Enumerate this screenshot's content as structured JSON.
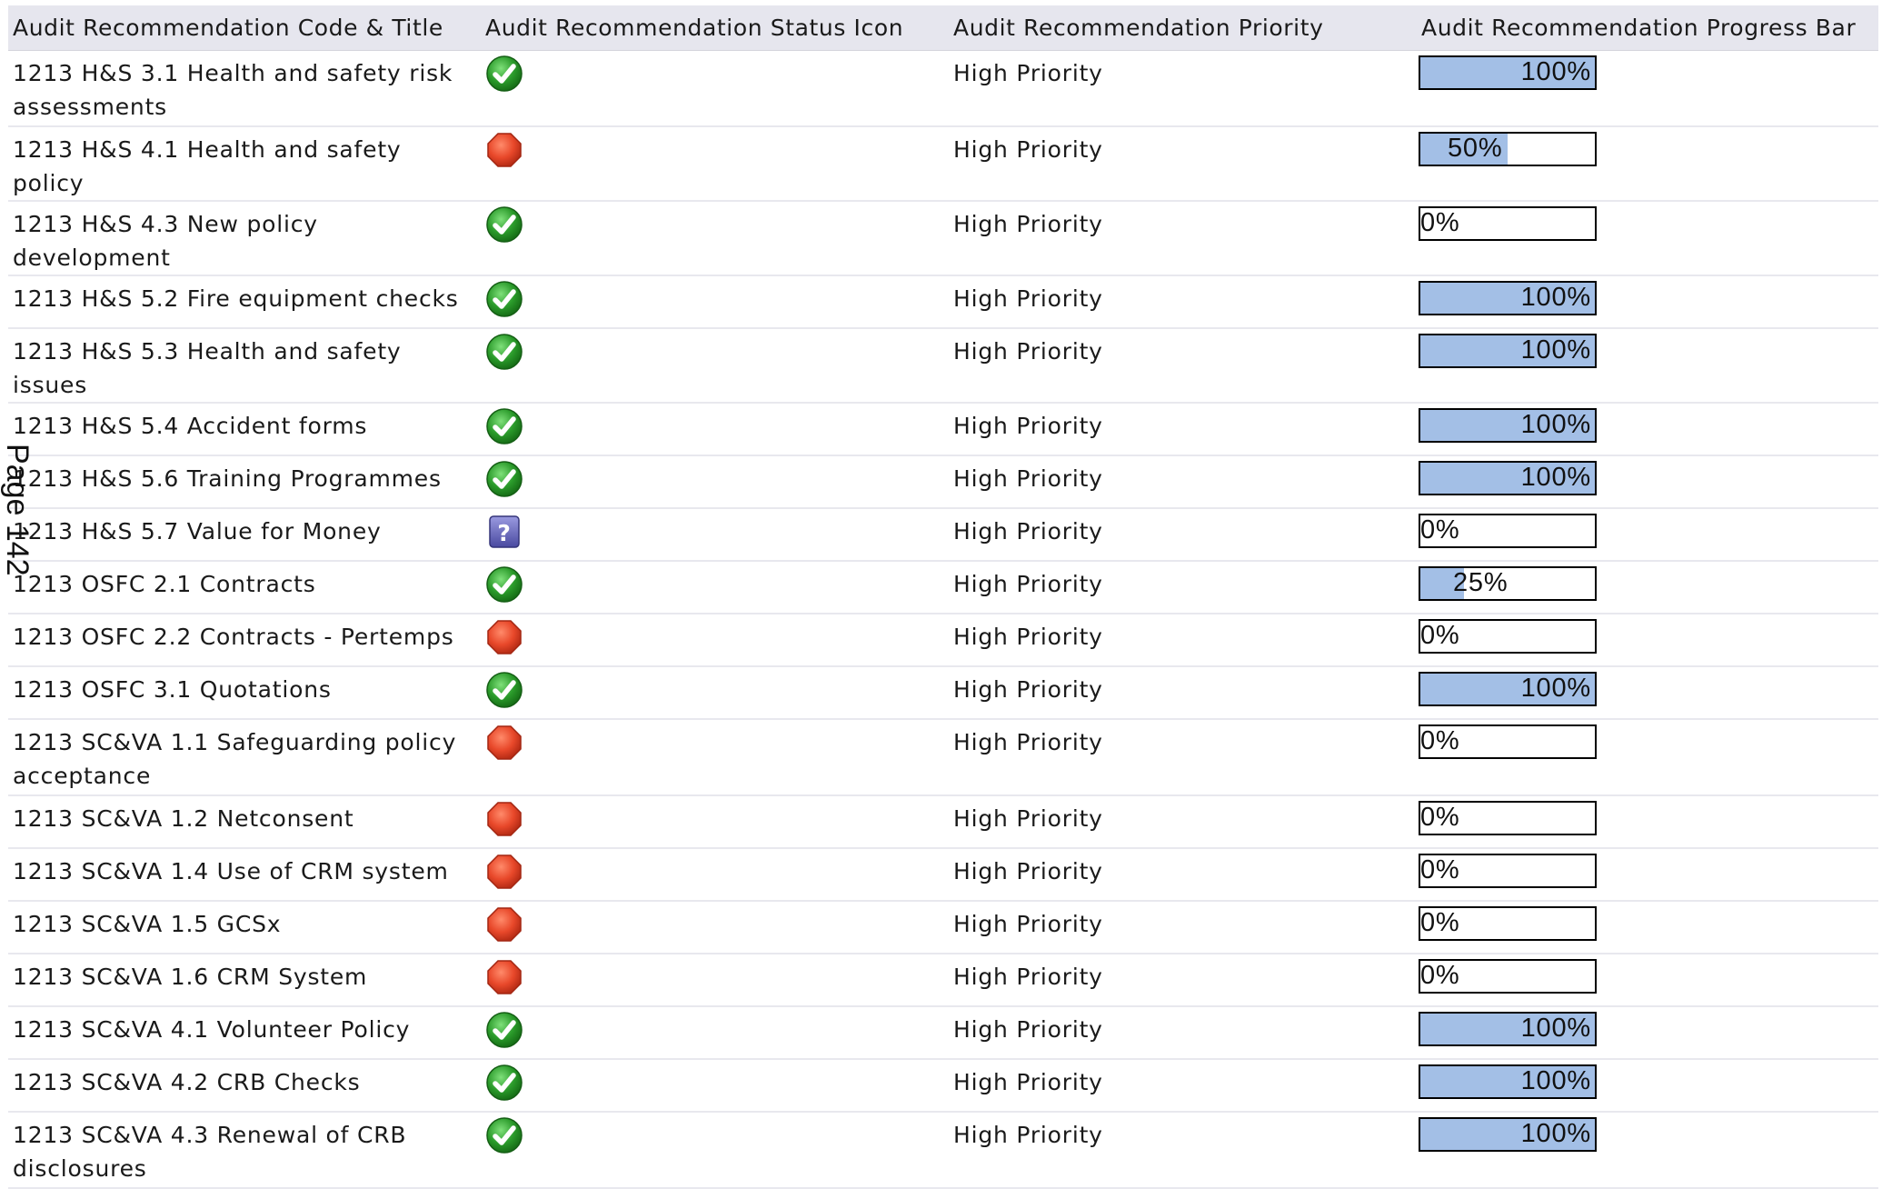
{
  "headers": [
    "Audit Recommendation Code & Title",
    "Audit Recommendation Status Icon",
    "Audit Recommendation Priority",
    "Audit Recommendation Progress Bar"
  ],
  "page_label": "Page 142",
  "status_colors": {
    "complete": "#2a9a2a",
    "not-started": "#e8482a",
    "unknown": "#5a5ab0"
  },
  "progress_fill_color": "#a3bfe6",
  "rows": [
    {
      "title": "1213 H&S 3.1 Health and safety risk assessments",
      "status_icon": "check-icon",
      "priority": "High Priority",
      "progress": 100,
      "progress_label": "100%"
    },
    {
      "title": "1213 H&S 4.1 Health and safety policy",
      "status_icon": "stop-octagon-icon",
      "priority": "High Priority",
      "progress": 50,
      "progress_label": "50%"
    },
    {
      "title": "1213 H&S 4.3 New policy development",
      "status_icon": "check-icon",
      "priority": "High Priority",
      "progress": 0,
      "progress_label": "0%"
    },
    {
      "title": "1213 H&S 5.2 Fire equipment checks",
      "status_icon": "check-icon",
      "priority": "High Priority",
      "progress": 100,
      "progress_label": "100%"
    },
    {
      "title": "1213 H&S 5.3 Health and safety issues",
      "status_icon": "check-icon",
      "priority": "High Priority",
      "progress": 100,
      "progress_label": "100%"
    },
    {
      "title": "1213 H&S 5.4 Accident forms",
      "status_icon": "check-icon",
      "priority": "High Priority",
      "progress": 100,
      "progress_label": "100%"
    },
    {
      "title": "1213 H&S 5.6 Training Programmes",
      "status_icon": "check-icon",
      "priority": "High Priority",
      "progress": 100,
      "progress_label": "100%"
    },
    {
      "title": "1213 H&S 5.7 Value for Money",
      "status_icon": "question-icon",
      "priority": "High Priority",
      "progress": 0,
      "progress_label": "0%"
    },
    {
      "title": "1213 OSFC 2.1 Contracts",
      "status_icon": "check-icon",
      "priority": "High Priority",
      "progress": 25,
      "progress_label": "25%"
    },
    {
      "title": "1213 OSFC 2.2 Contracts - Pertemps",
      "status_icon": "stop-octagon-icon",
      "priority": "High Priority",
      "progress": 0,
      "progress_label": "0%"
    },
    {
      "title": "1213 OSFC 3.1 Quotations",
      "status_icon": "check-icon",
      "priority": "High Priority",
      "progress": 100,
      "progress_label": "100%"
    },
    {
      "title": "1213 SC&VA 1.1 Safeguarding policy acceptance",
      "status_icon": "stop-octagon-icon",
      "priority": "High Priority",
      "progress": 0,
      "progress_label": "0%"
    },
    {
      "title": "1213 SC&VA 1.2 Netconsent",
      "status_icon": "stop-octagon-icon",
      "priority": "High Priority",
      "progress": 0,
      "progress_label": "0%"
    },
    {
      "title": "1213 SC&VA 1.4 Use of CRM system",
      "status_icon": "stop-octagon-icon",
      "priority": "High Priority",
      "progress": 0,
      "progress_label": "0%"
    },
    {
      "title": "1213 SC&VA 1.5 GCSx",
      "status_icon": "stop-octagon-icon",
      "priority": "High Priority",
      "progress": 0,
      "progress_label": "0%"
    },
    {
      "title": "1213 SC&VA 1.6 CRM System",
      "status_icon": "stop-octagon-icon",
      "priority": "High Priority",
      "progress": 0,
      "progress_label": "0%"
    },
    {
      "title": "1213 SC&VA 4.1 Volunteer Policy",
      "status_icon": "check-icon",
      "priority": "High Priority",
      "progress": 100,
      "progress_label": "100%"
    },
    {
      "title": "1213 SC&VA 4.2 CRB Checks",
      "status_icon": "check-icon",
      "priority": "High Priority",
      "progress": 100,
      "progress_label": "100%"
    },
    {
      "title": "1213 SC&VA 4.3 Renewal of CRB disclosures",
      "status_icon": "check-icon",
      "priority": "High Priority",
      "progress": 100,
      "progress_label": "100%"
    }
  ]
}
